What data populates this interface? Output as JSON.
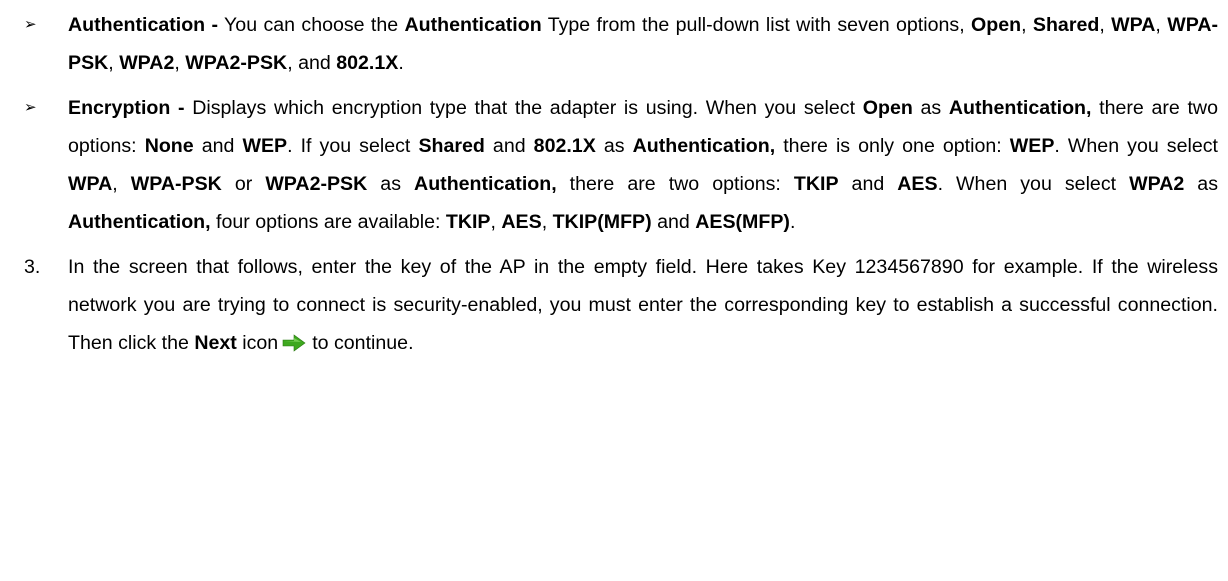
{
  "items": [
    {
      "marker": "➢",
      "segments": [
        {
          "t": "Authentication -",
          "b": true
        },
        {
          "t": " You can choose the ",
          "b": false
        },
        {
          "t": "Authentication",
          "b": true
        },
        {
          "t": " Type from the pull-down list with seven options, ",
          "b": false
        },
        {
          "t": "Open",
          "b": true
        },
        {
          "t": ", ",
          "b": false
        },
        {
          "t": "Shared",
          "b": true
        },
        {
          "t": ", ",
          "b": false
        },
        {
          "t": "WPA",
          "b": true
        },
        {
          "t": ", ",
          "b": false
        },
        {
          "t": "WPA-PSK",
          "b": true
        },
        {
          "t": ", ",
          "b": false
        },
        {
          "t": "WPA2",
          "b": true
        },
        {
          "t": ", ",
          "b": false
        },
        {
          "t": "WPA2-PSK",
          "b": true
        },
        {
          "t": ", and ",
          "b": false
        },
        {
          "t": "802.1X",
          "b": true
        },
        {
          "t": ".",
          "b": false
        }
      ]
    },
    {
      "marker": "➢",
      "segments": [
        {
          "t": "Encryption -",
          "b": true
        },
        {
          "t": " Displays which encryption type that the adapter is using. When you select ",
          "b": false
        },
        {
          "t": "Open",
          "b": true
        },
        {
          "t": " as ",
          "b": false
        },
        {
          "t": "Authentication,",
          "b": true
        },
        {
          "t": " there are two options: ",
          "b": false
        },
        {
          "t": "None",
          "b": true
        },
        {
          "t": " and ",
          "b": false
        },
        {
          "t": "WEP",
          "b": true
        },
        {
          "t": ". If you select ",
          "b": false
        },
        {
          "t": "Shared",
          "b": true
        },
        {
          "t": " and ",
          "b": false
        },
        {
          "t": "802.1X",
          "b": true
        },
        {
          "t": " as ",
          "b": false
        },
        {
          "t": "Authentication,",
          "b": true
        },
        {
          "t": " there is only one option: ",
          "b": false
        },
        {
          "t": "WEP",
          "b": true
        },
        {
          "t": ". When you select ",
          "b": false
        },
        {
          "t": "WPA",
          "b": true
        },
        {
          "t": ", ",
          "b": false
        },
        {
          "t": "WPA-PSK",
          "b": true
        },
        {
          "t": " or ",
          "b": false
        },
        {
          "t": "WPA2-PSK",
          "b": true
        },
        {
          "t": " as ",
          "b": false
        },
        {
          "t": "Authentication,",
          "b": true
        },
        {
          "t": " there are two options: ",
          "b": false
        },
        {
          "t": "TKIP",
          "b": true
        },
        {
          "t": " and ",
          "b": false
        },
        {
          "t": "AES",
          "b": true
        },
        {
          "t": ". When you select ",
          "b": false
        },
        {
          "t": "WPA2",
          "b": true
        },
        {
          "t": " as ",
          "b": false
        },
        {
          "t": "Authentication,",
          "b": true
        },
        {
          "t": " four options are available: ",
          "b": false
        },
        {
          "t": "TKIP",
          "b": true
        },
        {
          "t": ", ",
          "b": false
        },
        {
          "t": "AES",
          "b": true
        },
        {
          "t": ", ",
          "b": false
        },
        {
          "t": "TKIP(MFP)",
          "b": true
        },
        {
          "t": " and ",
          "b": false
        },
        {
          "t": "AES(MFP)",
          "b": true
        },
        {
          "t": ".",
          "b": false
        }
      ]
    },
    {
      "marker": "3.",
      "segments": [
        {
          "t": "In the screen that follows, enter the key of the AP in the empty field. Here takes Key 1234567890 for example. If the wireless network you are trying to connect is security-enabled, you must enter the corresponding key to establish a successful connection. Then click the ",
          "b": false
        },
        {
          "t": "Next",
          "b": true
        },
        {
          "t": " icon",
          "b": false
        },
        {
          "icon": "next-arrow-icon"
        },
        {
          "t": "to continue.",
          "b": false
        }
      ]
    }
  ],
  "icons": {
    "next_arrow_color": "#3ea81f"
  }
}
